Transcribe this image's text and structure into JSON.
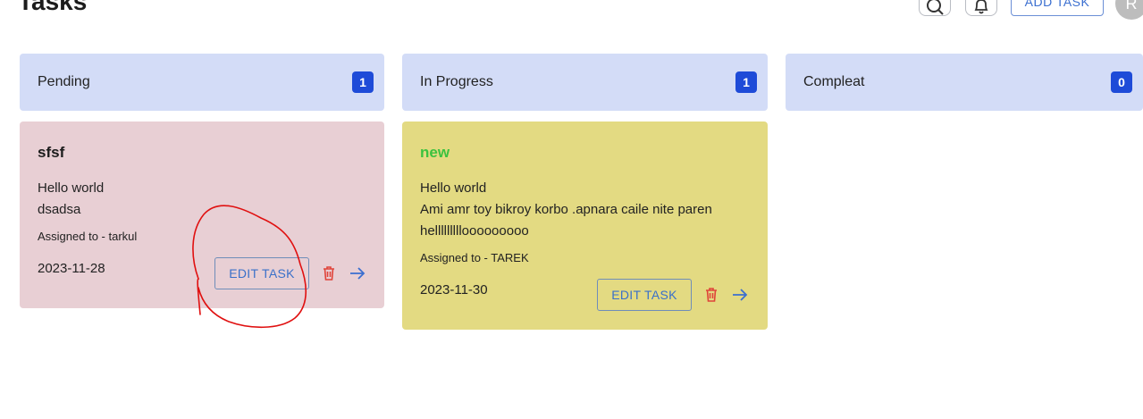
{
  "page": {
    "title": "Tasks"
  },
  "header": {
    "search_icon": "search-icon",
    "notification_icon": "bell-icon",
    "add_task_label": "ADD TASK",
    "avatar_initial": "R"
  },
  "columns": [
    {
      "label": "Pending",
      "count": "1"
    },
    {
      "label": "In Progress",
      "count": "1"
    },
    {
      "label": "Compleat",
      "count": "0"
    }
  ],
  "cards": [
    {
      "title": "sfsf",
      "description_lines": [
        "Hello world",
        "dsadsa"
      ],
      "assigned": "Assigned to - tarkul",
      "date": "2023-11-28",
      "edit_label": "EDIT TASK",
      "bg": "#e8cfd4",
      "title_color": "#1c1c1c"
    },
    {
      "title": "new",
      "description_lines": [
        "Hello world",
        "Ami amr toy bikroy korbo .apnara caile nite paren",
        "helllllllllooooooooo"
      ],
      "assigned": "Assigned to - TAREK",
      "date": "2023-11-30",
      "edit_label": "EDIT TASK",
      "bg": "#e3da82",
      "title_color": "#3cc23f"
    }
  ],
  "colors": {
    "accent": "#1e4bd8",
    "column_header_bg": "#d3dcf7",
    "delete_icon": "#e0443a",
    "arrow_icon": "#3b6fd0",
    "annotation": "#e01010"
  }
}
